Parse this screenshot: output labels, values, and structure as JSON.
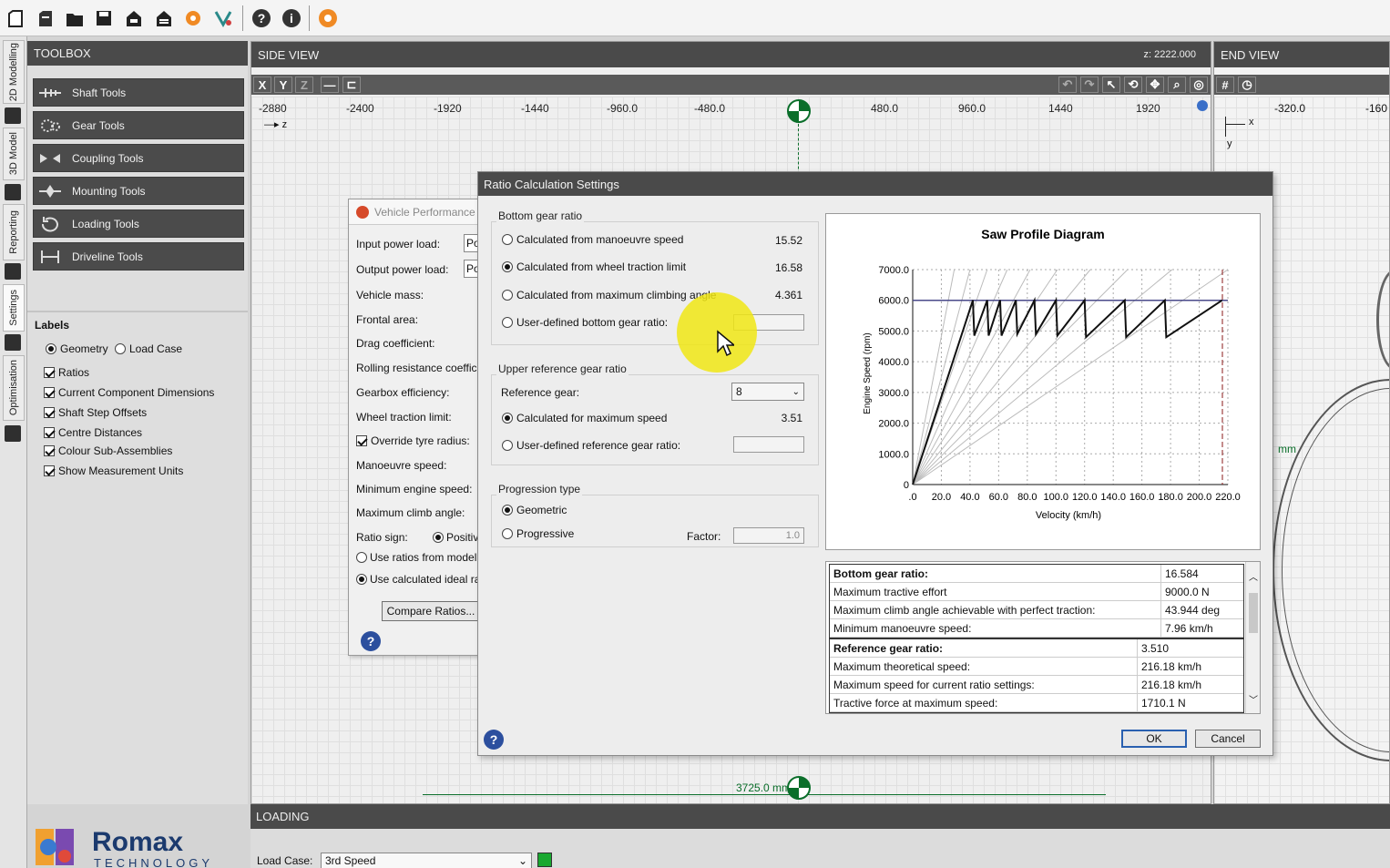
{
  "toolbar": {
    "icons": [
      "new-icon",
      "new-from-template-icon",
      "open-folder-icon",
      "save-icon",
      "save-as-icon",
      "save-all-icon",
      "plugin-icon",
      "design-icon",
      "help-icon",
      "info-icon",
      "settings-icon"
    ]
  },
  "vtabs": [
    "2D Modelling",
    "3D Model",
    "Reporting",
    "Settings",
    "Optimisation"
  ],
  "toolbox": {
    "title": "TOOLBOX",
    "tools": [
      "Shaft Tools",
      "Gear Tools",
      "Coupling Tools",
      "Mounting Tools",
      "Loading Tools",
      "Driveline Tools"
    ],
    "labels_title": "Labels",
    "radio_geometry": "Geometry",
    "radio_loadcase": "Load Case",
    "checks": [
      "Ratios",
      "Current Component Dimensions",
      "Shaft Step Offsets",
      "Centre Distances",
      "Colour Sub-Assemblies",
      "Show Measurement Units"
    ]
  },
  "side_view": {
    "title": "SIDE VIEW",
    "z_readout": "z: 2222.000",
    "axis_buttons": [
      "X",
      "Y",
      "Z"
    ],
    "ruler": [
      "-2880",
      "-2400",
      "-1920",
      "-1440",
      "-960.0",
      "-480.0",
      "480.0",
      "960.0",
      "1440",
      "1920"
    ],
    "z_axis": "z",
    "dimension": "3725.0 mm"
  },
  "end_view": {
    "title": "END VIEW",
    "ruler": [
      "-320.0",
      "-160"
    ],
    "axis_x": "x",
    "axis_y": "y",
    "unit": "mm"
  },
  "vehicle_perf": {
    "title": "Vehicle Performance",
    "rows": [
      "Input power load:",
      "Output power load:",
      "Vehicle mass:",
      "Frontal area:",
      "Drag coefficient:",
      "Rolling resistance coefficien",
      "Gearbox efficiency:",
      "Wheel traction limit:",
      "Override tyre radius:",
      "Manoeuvre speed:",
      "Minimum engine speed:",
      "Maximum climb angle:",
      "Ratio sign:"
    ],
    "input_power_value": "Po",
    "output_power_value": "Po",
    "ratio_sign_option": "Positive",
    "use_ratios_model": "Use ratios from model",
    "use_calculated": "Use calculated ideal ratio",
    "compare_button": "Compare Ratios..."
  },
  "ratio_dialog": {
    "title": "Ratio Calculation Settings",
    "bottom_group": "Bottom gear ratio",
    "bottom_options": [
      {
        "label": "Calculated from manoeuvre speed",
        "value": "15.52"
      },
      {
        "label": "Calculated from wheel traction limit",
        "value": "16.58"
      },
      {
        "label": "Calculated from maximum climbing angle",
        "value": "4.361"
      },
      {
        "label": "User-defined bottom gear ratio:",
        "value": ""
      }
    ],
    "upper_group": "Upper reference gear ratio",
    "reference_gear_label": "Reference gear:",
    "reference_gear_value": "8",
    "upper_options": [
      {
        "label": "Calculated for maximum speed",
        "value": "3.51"
      },
      {
        "label": "User-defined reference gear ratio:",
        "value": ""
      }
    ],
    "progression_group": "Progression type",
    "prog_geometric": "Geometric",
    "prog_progressive": "Progressive",
    "factor_label": "Factor:",
    "factor_value": "1.0",
    "ok": "OK",
    "cancel": "Cancel",
    "results_bottom": [
      [
        "Bottom gear ratio:",
        "16.584"
      ],
      [
        "Maximum tractive effort",
        "9000.0 N"
      ],
      [
        "Maximum climb angle achievable with perfect traction:",
        "43.944 deg"
      ],
      [
        "Minimum manoeuvre speed:",
        "7.96 km/h"
      ]
    ],
    "results_ref": [
      [
        "Reference gear ratio:",
        "3.510"
      ],
      [
        "Maximum theoretical speed:",
        "216.18 km/h"
      ],
      [
        "Maximum speed for current ratio settings:",
        "216.18 km/h"
      ],
      [
        "Tractive force at maximum speed:",
        "1710.1 N"
      ]
    ]
  },
  "chart_data": {
    "type": "line",
    "title": "Saw Profile Diagram",
    "xlabel": "Velocity (km/h)",
    "ylabel": "Engine Speed (rpm)",
    "xlim": [
      0,
      220
    ],
    "ylim": [
      0,
      7000
    ],
    "xticks": [
      ".0",
      "20.0",
      "40.0",
      "60.0",
      "80.0",
      "100.0",
      "120.0",
      "140.0",
      "160.0",
      "180.0",
      "200.0",
      "220.0"
    ],
    "yticks": [
      "0",
      "1000.0",
      "2000.0",
      "3000.0",
      "4000.0",
      "5000.0",
      "6000.0",
      "7000.0"
    ],
    "max_rpm_line": 6000,
    "max_speed_marker": 216.18,
    "gear_lines_end_speed": [
      29,
      40,
      52,
      66,
      82,
      101,
      124,
      150,
      181,
      220
    ],
    "saw_profile": [
      [
        0,
        0
      ],
      [
        42,
        6000
      ],
      [
        43,
        4850
      ],
      [
        52,
        6000
      ],
      [
        53,
        4850
      ],
      [
        61,
        6000
      ],
      [
        62,
        4850
      ],
      [
        72,
        6000
      ],
      [
        73,
        4900
      ],
      [
        85,
        6000
      ],
      [
        86,
        4900
      ],
      [
        100,
        6000
      ],
      [
        101,
        4850
      ],
      [
        120,
        6000
      ],
      [
        121,
        4800
      ],
      [
        148,
        6000
      ],
      [
        149,
        4800
      ],
      [
        176,
        6000
      ],
      [
        177,
        4800
      ],
      [
        216,
        6000
      ]
    ]
  },
  "loading": {
    "title": "LOADING",
    "load_case_label": "Load Case:",
    "load_case_value": "3rd Speed"
  },
  "logo": {
    "brand": "Romax",
    "sub": "TECHNOLOGY"
  }
}
